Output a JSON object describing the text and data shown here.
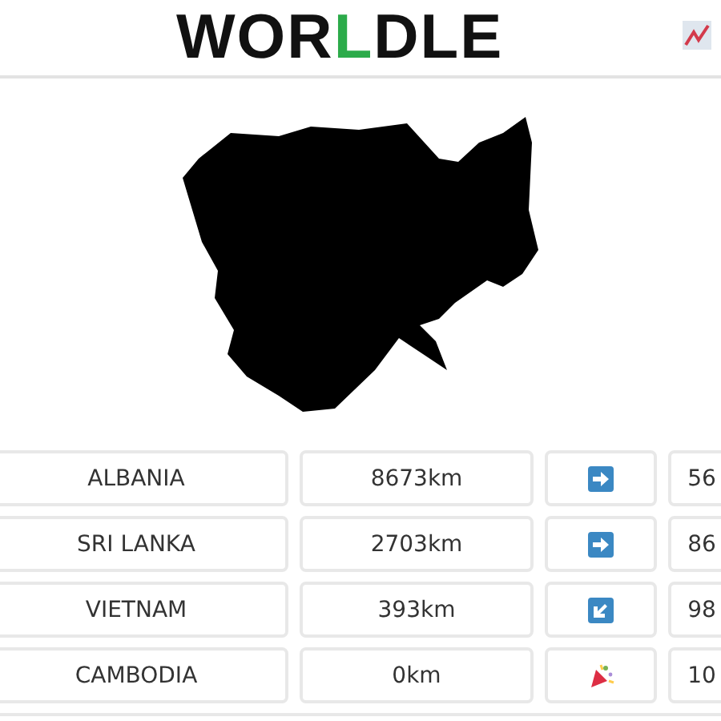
{
  "header": {
    "title_parts": [
      {
        "text": "WOR",
        "color": "#111111"
      },
      {
        "text": "L",
        "color": "#2cab4a"
      },
      {
        "text": "DLE",
        "color": "#111111"
      }
    ]
  },
  "guesses": [
    {
      "country": "ALBANIA",
      "distance": "8673km",
      "kind": "east",
      "proximity": "56"
    },
    {
      "country": "SRI LANKA",
      "distance": "2703km",
      "kind": "east",
      "proximity": "86"
    },
    {
      "country": "VIETNAM",
      "distance": "393km",
      "kind": "southwest",
      "proximity": "98"
    },
    {
      "country": "CAMBODIA",
      "distance": "0km",
      "kind": "win",
      "proximity": "10"
    }
  ]
}
